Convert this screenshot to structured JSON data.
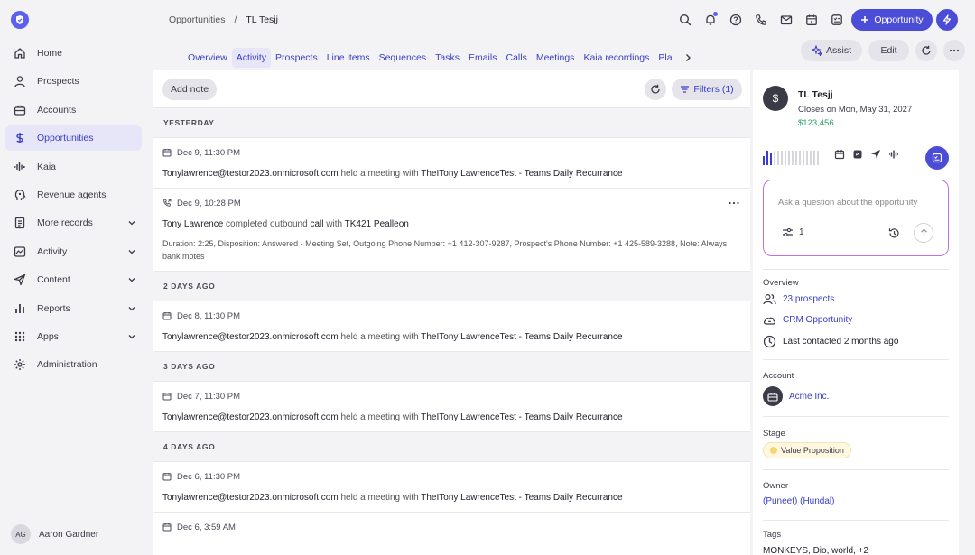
{
  "app": {
    "logo_icon": "shield-logo-icon",
    "accent": "#4b4dd6"
  },
  "sidebar": {
    "items": [
      {
        "label": "Home",
        "icon": "home-icon"
      },
      {
        "label": "Prospects",
        "icon": "person-icon"
      },
      {
        "label": "Accounts",
        "icon": "briefcase-icon"
      },
      {
        "label": "Opportunities",
        "icon": "dollar-icon",
        "active": true
      },
      {
        "label": "Kaia",
        "icon": "waveform-icon"
      },
      {
        "label": "Revenue agents",
        "icon": "agent-icon"
      },
      {
        "label": "More records",
        "icon": "records-icon",
        "expandable": true
      },
      {
        "label": "Activity",
        "icon": "activity-icon",
        "expandable": true
      },
      {
        "label": "Content",
        "icon": "send-icon",
        "expandable": true
      },
      {
        "label": "Reports",
        "icon": "bar-chart-icon",
        "expandable": true
      },
      {
        "label": "Apps",
        "icon": "grid-icon",
        "expandable": true
      },
      {
        "label": "Administration",
        "icon": "gear-icon"
      }
    ],
    "user": {
      "initials": "AG",
      "name": "Aaron Gardner"
    }
  },
  "breadcrumb": {
    "parent": "Opportunities",
    "separator": "/",
    "current": "TL Tesjj"
  },
  "header": {
    "primary_button": "Opportunity"
  },
  "tabs": [
    "Overview",
    "Activity",
    "Prospects",
    "Line items",
    "Sequences",
    "Tasks",
    "Emails",
    "Calls",
    "Meetings",
    "Kaia recordings",
    "Pla"
  ],
  "actions": {
    "assist": "Assist",
    "edit": "Edit"
  },
  "feed": {
    "add_note": "Add note",
    "filters": "Filters (1)",
    "sections": [
      {
        "label": "YESTERDAY",
        "items": [
          {
            "type": "meeting",
            "time": "Dec 9, 11:30 PM",
            "actor": "Tonylawrence@testor2023.onmicrosoft.com",
            "verb": "held a meeting with",
            "target": "TheITony LawrenceTest",
            "suffix": "- Teams Daily Recurrance"
          },
          {
            "type": "call",
            "time": "Dec 9, 10:28 PM",
            "actor": "Tony Lawrence",
            "verb": "completed outbound",
            "obj": "call",
            "with": "with",
            "target": "TK421 Pealleon",
            "details": "Duration: 2:25, Disposition: Answered - Meeting Set, Outgoing Phone Number: +1 412-307-9287, Prospect's Phone Number: +1 425-589-3288, Note: Always bank motes"
          }
        ]
      },
      {
        "label": "2 DAYS AGO",
        "items": [
          {
            "type": "meeting",
            "time": "Dec 8, 11:30 PM",
            "actor": "Tonylawrence@testor2023.onmicrosoft.com",
            "verb": "held a meeting with",
            "target": "TheITony LawrenceTest",
            "suffix": "- Teams Daily Recurrance"
          }
        ]
      },
      {
        "label": "3 DAYS AGO",
        "items": [
          {
            "type": "meeting",
            "time": "Dec 7, 11:30 PM",
            "actor": "Tonylawrence@testor2023.onmicrosoft.com",
            "verb": "held a meeting with",
            "target": "TheITony LawrenceTest",
            "suffix": "- Teams Daily Recurrance"
          }
        ]
      },
      {
        "label": "4 DAYS AGO",
        "items": [
          {
            "type": "meeting",
            "time": "Dec 6, 11:30 PM",
            "actor": "Tonylawrence@testor2023.onmicrosoft.com",
            "verb": "held a meeting with",
            "target": "TheITony LawrenceTest",
            "suffix": "- Teams Daily Recurrance"
          },
          {
            "type": "meeting",
            "time": "Dec 6, 3:59 AM"
          }
        ]
      }
    ]
  },
  "panel": {
    "title": "TL Tesjj",
    "closes": "Closes on Mon, May 31, 2027",
    "amount": "$123,456",
    "ask_placeholder": "Ask a question about the opportunity",
    "filter_count": "1",
    "overview_label": "Overview",
    "prospects": "23 prospects",
    "crm": "CRM Opportunity",
    "last_contacted": "Last contacted 2 months ago",
    "account_label": "Account",
    "account": "Acme Inc.",
    "stage_label": "Stage",
    "stage": "Value Proposition",
    "stage_color": "#f4d76e",
    "owner_label": "Owner",
    "owner": "(Puneet) (Hundal)",
    "tags_label": "Tags",
    "tags": "MONKEYS, Dio, world, +2"
  }
}
